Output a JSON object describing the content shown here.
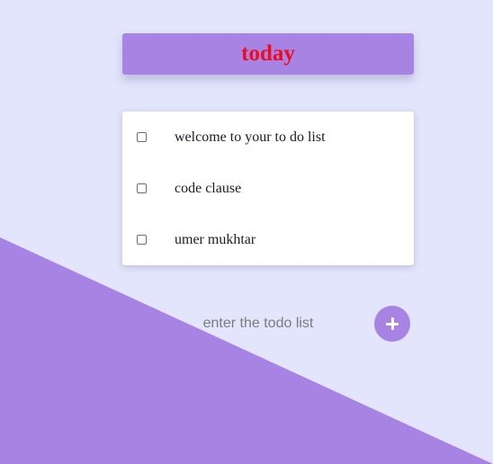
{
  "header": {
    "title": "today"
  },
  "todos": [
    {
      "text": "welcome to your to do list",
      "checked": false
    },
    {
      "text": "code clause",
      "checked": false
    },
    {
      "text": "umer mukhtar",
      "checked": false
    }
  ],
  "input": {
    "value": "",
    "placeholder": "enter the todo list"
  },
  "add_button": {
    "icon": "plus-icon"
  },
  "colors": {
    "background": "#e2e5fb",
    "accent": "#a783e3",
    "title": "#ef0a1f",
    "card": "#ffffff"
  }
}
